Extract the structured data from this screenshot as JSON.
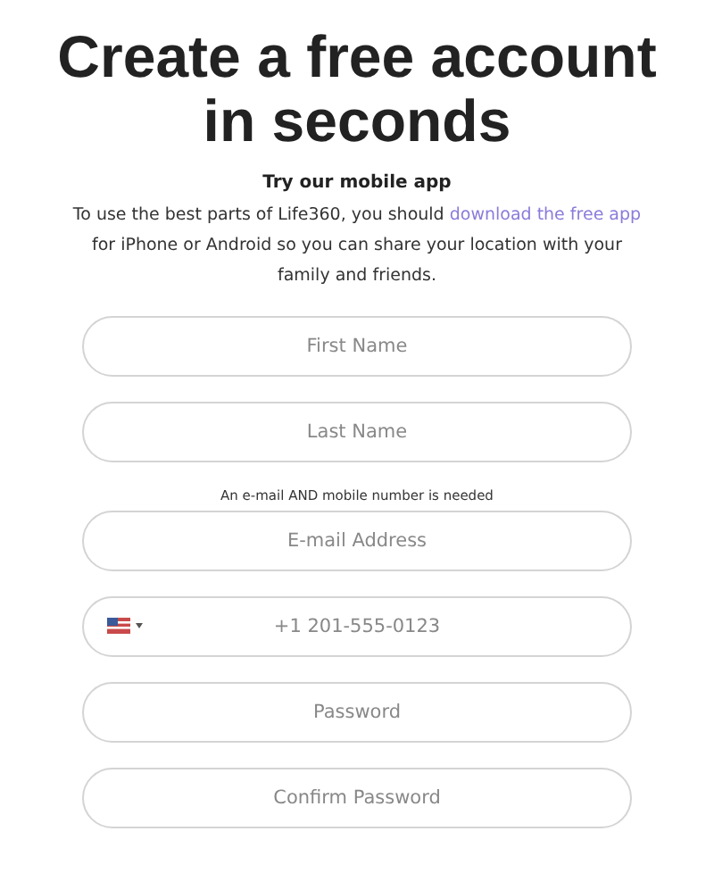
{
  "heading": "Create a free account in seconds",
  "promo": {
    "title": "Try our mobile app",
    "text_before": "To use the best parts of Life360, you should ",
    "link": "download the free app",
    "text_after": " for iPhone or Android so you can share your location with your family and friends."
  },
  "fields": [
    {
      "kind": "text",
      "placeholder": "First Name"
    },
    {
      "kind": "text",
      "placeholder": "Last Name"
    },
    {
      "kind": "note",
      "text": "An e-mail AND mobile number is needed"
    },
    {
      "kind": "text",
      "placeholder": "E-mail Address"
    },
    {
      "kind": "phone",
      "placeholder": "+1 201-555-0123"
    },
    {
      "kind": "password",
      "placeholder": "Password"
    },
    {
      "kind": "password",
      "placeholder": "Confirm Password"
    }
  ]
}
